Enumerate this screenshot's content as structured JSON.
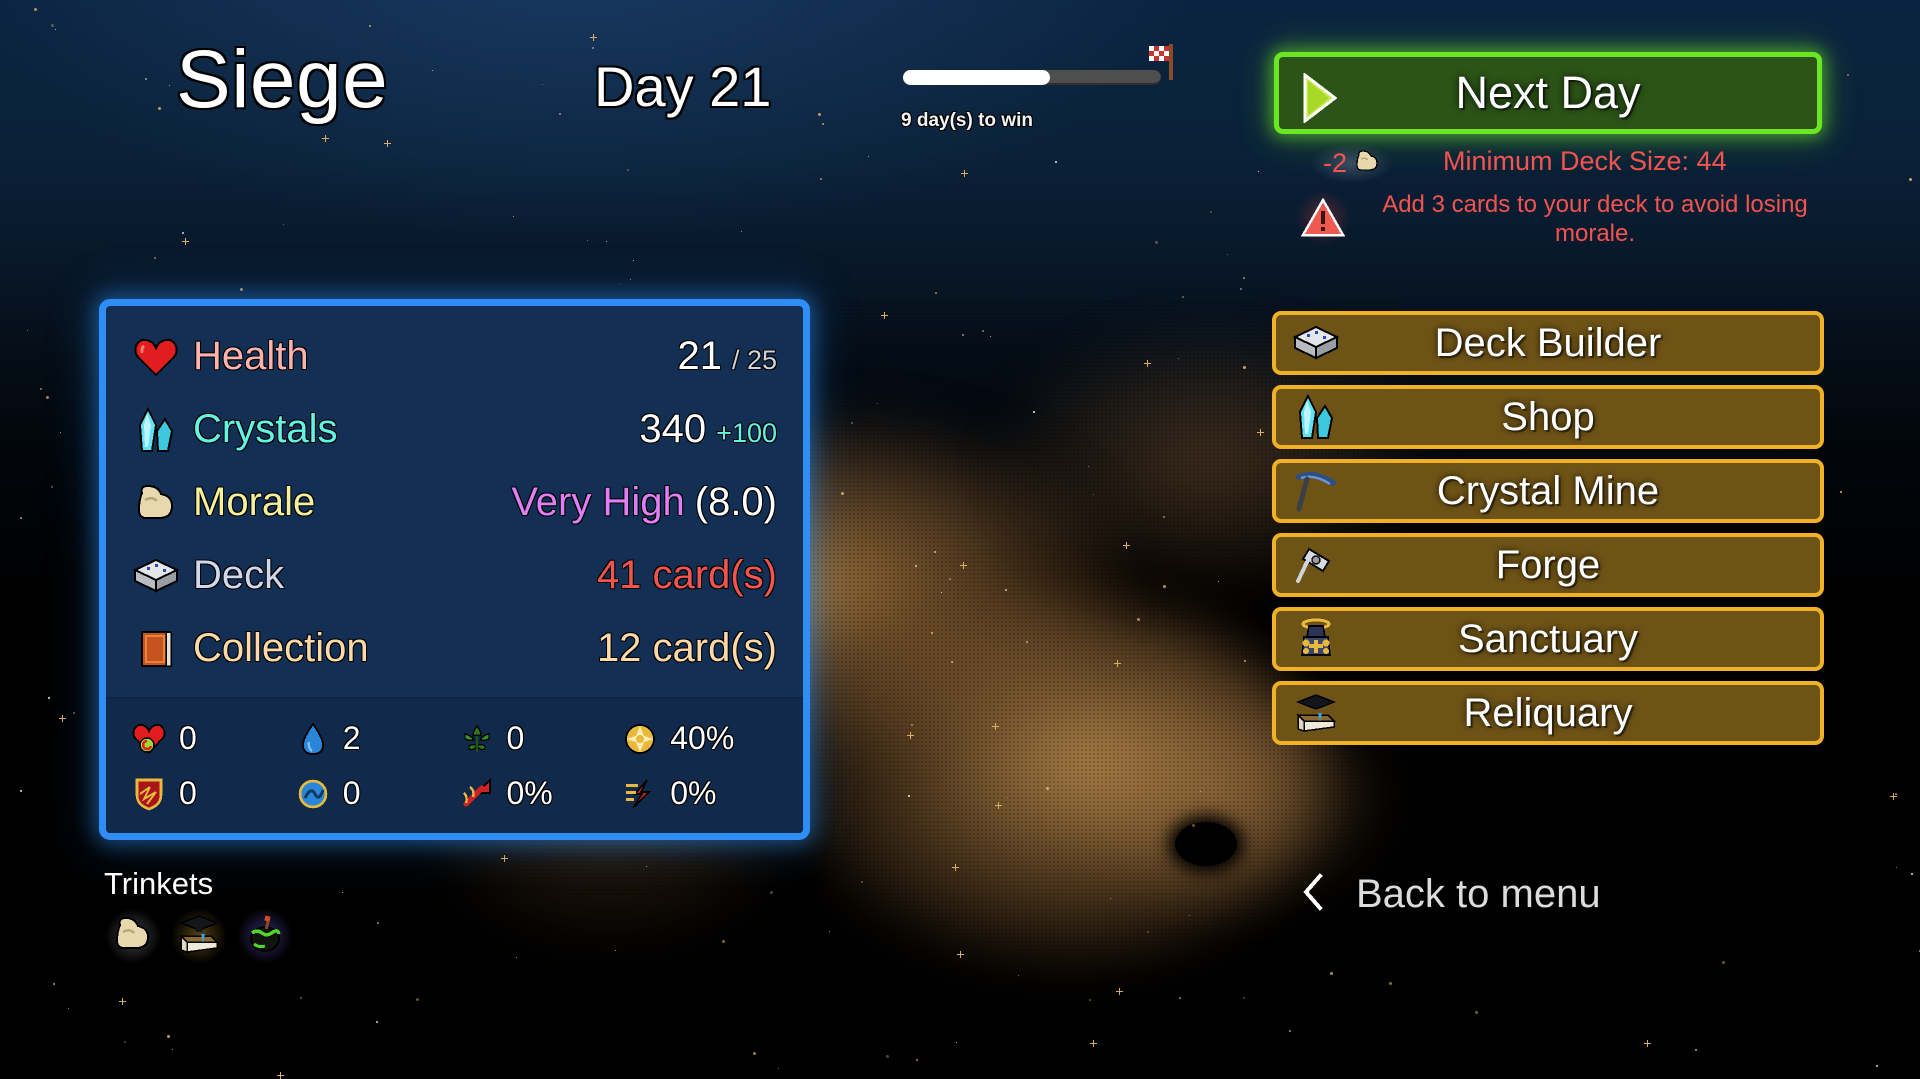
{
  "header": {
    "game_title": "Siege",
    "day_label": "Day 21",
    "progress_caption": "9 day(s) to win",
    "progress_percent": 57,
    "flag_icon": "checkered-flag-icon"
  },
  "next_day": {
    "label": "Next Day",
    "play_icon": "play-triangle-icon",
    "morale_delta": "-2",
    "morale_icon": "bicep-icon",
    "min_deck_text": "Minimum Deck Size: 44",
    "warning_icon": "warning-triangle-icon",
    "warning_text": "Add 3 cards to your deck to avoid losing morale."
  },
  "stats": {
    "rows": [
      {
        "icon": "heart-icon",
        "name": "Health",
        "value": "21",
        "sub": "/ 25"
      },
      {
        "icon": "crystal-icon",
        "name": "Crystals",
        "value": "340",
        "sub": "+100"
      },
      {
        "icon": "bicep-icon",
        "name": "Morale",
        "value": "Very High",
        "sub": "(8.0)"
      },
      {
        "icon": "card-deck-icon",
        "name": "Deck",
        "value": "41 card(s)",
        "sub": ""
      },
      {
        "icon": "book-icon",
        "name": "Collection",
        "value": "12 card(s)",
        "sub": ""
      }
    ],
    "grid": [
      {
        "icon": "heart-regen-icon",
        "value": "0"
      },
      {
        "icon": "water-drop-icon",
        "value": "2"
      },
      {
        "icon": "leaf-icon",
        "value": "0"
      },
      {
        "icon": "gold-burst-icon",
        "value": "40%"
      },
      {
        "icon": "shield-icon",
        "value": "0"
      },
      {
        "icon": "blue-orb-icon",
        "value": "0"
      },
      {
        "icon": "red-arrow-icon",
        "value": "0%"
      },
      {
        "icon": "lightning-axe-icon",
        "value": "0%"
      }
    ]
  },
  "trinkets": {
    "label": "Trinkets",
    "items": [
      {
        "icon": "bicep-trinket-icon",
        "glow": "gray"
      },
      {
        "icon": "graduation-book-icon",
        "glow": "gold"
      },
      {
        "icon": "green-cauldron-icon",
        "glow": "purple"
      }
    ]
  },
  "menu": {
    "items": [
      {
        "icon": "card-deck-icon",
        "label": "Deck Builder"
      },
      {
        "icon": "crystal-icon",
        "label": "Shop"
      },
      {
        "icon": "pickaxe-icon",
        "label": "Crystal Mine"
      },
      {
        "icon": "hammer-icon",
        "label": "Forge"
      },
      {
        "icon": "shrine-icon",
        "label": "Sanctuary"
      },
      {
        "icon": "graduation-book-icon",
        "label": "Reliquary"
      }
    ],
    "back": {
      "icon": "chevron-left-icon",
      "label": "Back to menu"
    }
  },
  "colors": {
    "accent_blue": "#2f8ef5",
    "accent_gold": "#f0b126",
    "accent_green": "#6ce622",
    "danger_red": "#f4544f",
    "panel_bg": "#132f54"
  }
}
